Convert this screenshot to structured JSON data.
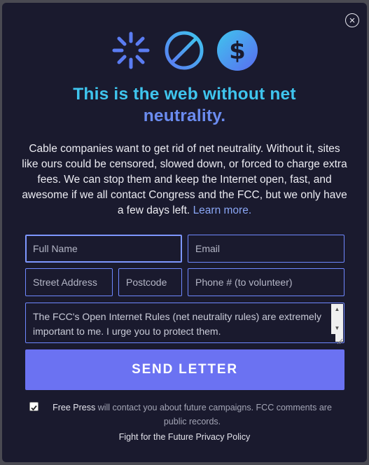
{
  "modal": {
    "close_label": "×",
    "icons": [
      "loading-spinner-icon",
      "blocked-circle-icon",
      "dollar-coin-icon"
    ],
    "title_line1": "This is the web without net",
    "title_line2": "neutrality.",
    "body": "Cable companies want to get rid of net neutrality. Without it, sites like ours could be censored, slowed down, or forced to charge extra fees. We can stop them and keep the Internet open, fast, and awesome if we all contact Congress and the FCC, but we only have a few days left.",
    "learn_more": "Learn more.",
    "colors": {
      "background": "#1a1a2e",
      "title_cyan": "#3fc5ee",
      "title_blue": "#6b8cf0",
      "button": "#6b72f2",
      "field_border": "#6f88ff"
    }
  },
  "form": {
    "full_name_placeholder": "Full Name",
    "email_placeholder": "Email",
    "street_placeholder": "Street Address",
    "postcode_placeholder": "Postcode",
    "phone_placeholder": "Phone # (to volunteer)",
    "letter_text": "The FCC's Open Internet Rules (net neutrality rules) are extremely important to me. I urge you to protect them.",
    "send_label": "SEND LETTER"
  },
  "consent": {
    "checked": true,
    "org": "Free Press",
    "text": "will contact you about future campaigns. FCC comments are public records."
  },
  "footer": {
    "privacy_link": "Fight for the Future Privacy Policy"
  }
}
